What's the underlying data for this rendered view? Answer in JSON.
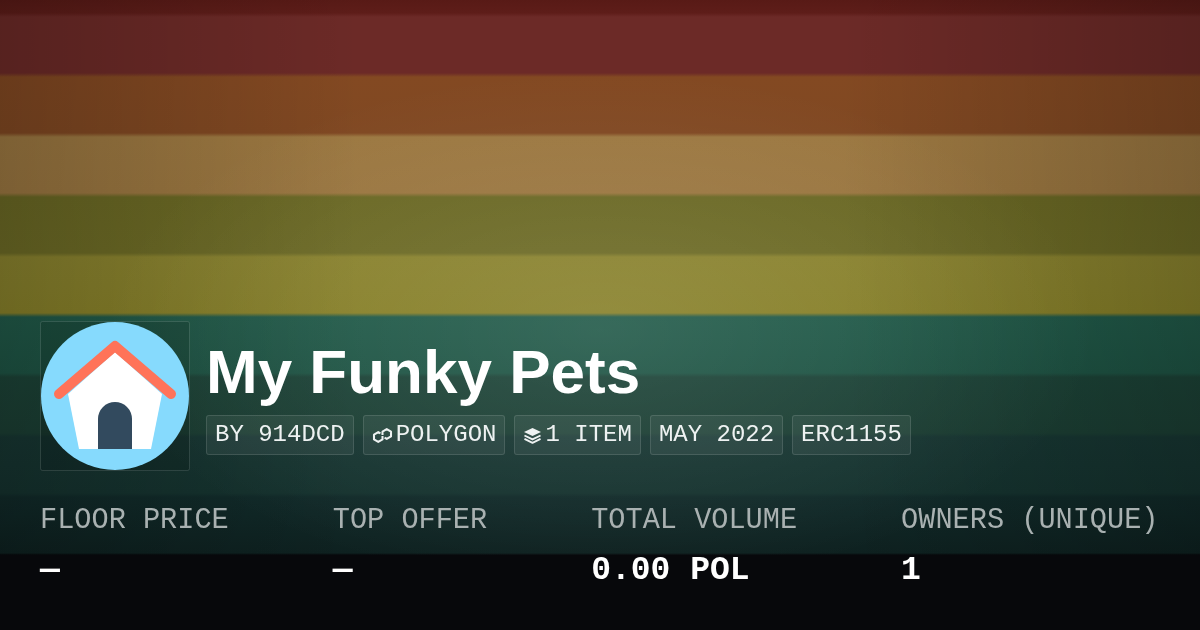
{
  "collection": {
    "name": "My Funky Pets",
    "tags": [
      {
        "kind": "creator",
        "label": "BY 914DCD"
      },
      {
        "kind": "chain",
        "label": "POLYGON"
      },
      {
        "kind": "items",
        "label": "1 ITEM"
      },
      {
        "kind": "date",
        "label": "MAY 2022"
      },
      {
        "kind": "standard",
        "label": "ERC1155"
      }
    ]
  },
  "stats": [
    {
      "label": "FLOOR PRICE",
      "value": "—"
    },
    {
      "label": "TOP OFFER",
      "value": "—"
    },
    {
      "label": "TOTAL VOLUME",
      "value": "0.00 POL"
    },
    {
      "label": "OWNERS (UNIQUE)",
      "value": "1"
    }
  ]
}
